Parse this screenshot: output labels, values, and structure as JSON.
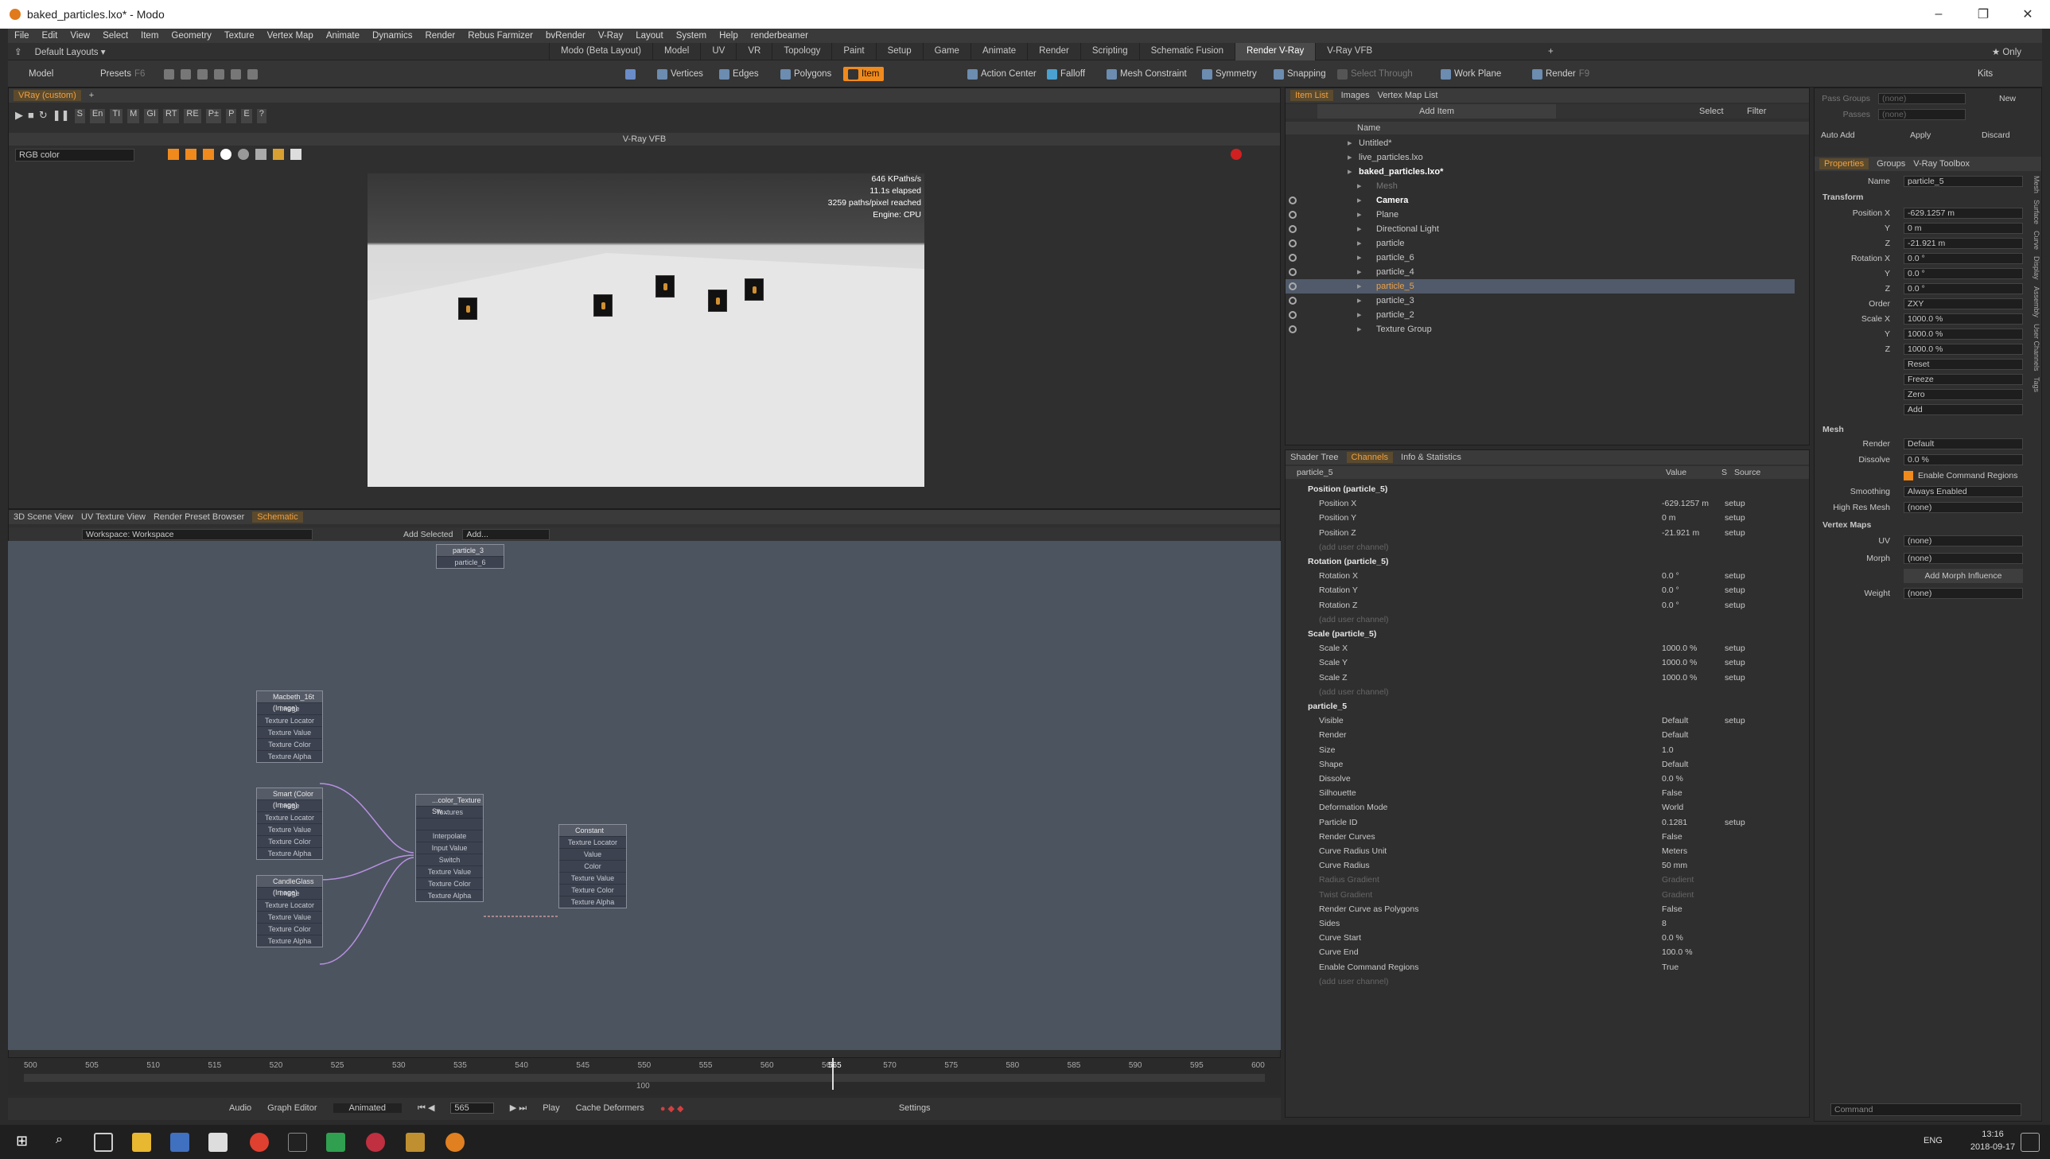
{
  "window": {
    "title": "baked_particles.lxo* - Modo",
    "min": "–",
    "max": "❐",
    "close": "✕"
  },
  "menu": [
    "File",
    "Edit",
    "View",
    "Select",
    "Item",
    "Geometry",
    "Texture",
    "Vertex Map",
    "Animate",
    "Dynamics",
    "Render",
    "Rebus Farmizer",
    "bvRender",
    "V-Ray",
    "Layout",
    "System",
    "Help",
    "renderbeamer"
  ],
  "layout": {
    "label": "Default Layouts ▾",
    "tabs": [
      "Modo (Beta Layout)",
      "Model",
      "UV",
      "VR",
      "Topology",
      "Paint",
      "Setup",
      "Game",
      "Animate",
      "Render",
      "Scripting",
      "Schematic Fusion",
      "Render V-Ray",
      "V-Ray VFB"
    ],
    "active_tab": "Render V-Ray",
    "plus": "+",
    "only": "★ Only"
  },
  "toolbar": {
    "model": "Model",
    "presets": "Presets",
    "presets_key": "F6",
    "vertices": "Vertices",
    "edges": "Edges",
    "polygons": "Polygons",
    "item": "Item",
    "action_center": "Action Center",
    "falloff": "Falloff",
    "mesh_constraint": "Mesh Constraint",
    "symmetry": "Symmetry",
    "snapping": "Snapping",
    "select_through": "Select Through",
    "work_plane": "Work Plane",
    "render": "Render",
    "render_key": "F9",
    "kits": "Kits"
  },
  "vfb": {
    "tab": "VRay (custom)",
    "title": "V-Ray VFB",
    "channel": "RGB color",
    "stats": [
      "646 KPaths/s",
      "11.1s elapsed",
      "3259 paths/pixel reached",
      "Engine: CPU"
    ],
    "buttons": [
      "S",
      "En",
      "TI",
      "M",
      "GI",
      "RT",
      "RE",
      "P±",
      "P",
      "E",
      "?"
    ]
  },
  "schematic": {
    "tabs": [
      "3D Scene View",
      "UV Texture View",
      "Render Preset Browser",
      "Schematic"
    ],
    "active": "Schematic",
    "workspace": "Workspace: Workspace",
    "add_selected": "Add Selected",
    "add": "Add...",
    "nodes": [
      {
        "title": "Macbeth_16t (Image)",
        "rows": [
          "Image",
          "Texture Locator",
          "Texture Value",
          "Texture Color",
          "Texture Alpha"
        ]
      },
      {
        "title": "Smart (Color (Image)",
        "rows": [
          "Image",
          "Texture Locator",
          "Texture Value",
          "Texture Color",
          "Texture Alpha"
        ]
      },
      {
        "title": "CandleGlass (Image)",
        "rows": [
          "Image",
          "Texture Locator",
          "Texture Value",
          "Texture Color",
          "Texture Alpha"
        ]
      },
      {
        "title": "...color_Texture Sw...",
        "rows": [
          "Textures",
          "",
          "Interpolate",
          "Input Value",
          "Switch",
          "Texture Value",
          "Texture Color",
          "Texture Alpha"
        ]
      },
      {
        "title": "Constant",
        "rows": [
          "Texture Locator",
          "Value",
          "Color",
          "Texture Value",
          "Texture Color",
          "Texture Alpha"
        ]
      },
      {
        "title": "particle_3",
        "rows": [
          "particle_6"
        ]
      }
    ]
  },
  "timeline": {
    "ticks": [
      "500",
      "505",
      "510",
      "515",
      "520",
      "525",
      "530",
      "535",
      "540",
      "545",
      "550",
      "555",
      "560",
      "565",
      "570",
      "575",
      "580",
      "585",
      "590",
      "595",
      "600"
    ],
    "markers": [
      "100",
      "565"
    ],
    "audio": "Audio",
    "graph_editor": "Graph Editor",
    "animated": "Animated",
    "frame": "565",
    "play": "Play",
    "cache": "Cache Deformers",
    "settings": "Settings"
  },
  "itemlist": {
    "tabs": [
      "Item List",
      "Images",
      "Vertex Map List"
    ],
    "add_item": "Add Item",
    "select": "Select",
    "filter": "Filter",
    "col": "Name",
    "items": [
      {
        "name": "Untitled*",
        "indent": 0
      },
      {
        "name": "live_particles.lxo",
        "indent": 0
      },
      {
        "name": "baked_particles.lxo*",
        "indent": 0,
        "bold": true
      },
      {
        "name": "Mesh",
        "indent": 1,
        "dim": true
      },
      {
        "name": "Camera",
        "indent": 1,
        "bold": true
      },
      {
        "name": "Plane",
        "indent": 1
      },
      {
        "name": "Directional Light",
        "indent": 1
      },
      {
        "name": "particle",
        "indent": 1
      },
      {
        "name": "particle_6",
        "indent": 1
      },
      {
        "name": "particle_4",
        "indent": 1
      },
      {
        "name": "particle_5",
        "indent": 1,
        "sel": true
      },
      {
        "name": "particle_3",
        "indent": 1
      },
      {
        "name": "particle_2",
        "indent": 1
      },
      {
        "name": "Texture Group",
        "indent": 1
      }
    ]
  },
  "channels": {
    "tabs": [
      "Shader Tree",
      "Channels",
      "Info & Statistics"
    ],
    "active": "Channels",
    "header": [
      "particle_5",
      "Value",
      "S",
      "Source"
    ],
    "rows": [
      {
        "n": "Position (particle_5)",
        "g": true
      },
      {
        "n": "Position X",
        "v": "-629.1257 m",
        "s": "setup"
      },
      {
        "n": "Position Y",
        "v": "0 m",
        "s": "setup"
      },
      {
        "n": "Position Z",
        "v": "-21.921 m",
        "s": "setup"
      },
      {
        "n": "(add user channel)",
        "d": true
      },
      {
        "n": "Rotation (particle_5)",
        "g": true
      },
      {
        "n": "Rotation X",
        "v": "0.0 °",
        "s": "setup"
      },
      {
        "n": "Rotation Y",
        "v": "0.0 °",
        "s": "setup"
      },
      {
        "n": "Rotation Z",
        "v": "0.0 °",
        "s": "setup"
      },
      {
        "n": "(add user channel)",
        "d": true
      },
      {
        "n": "Scale (particle_5)",
        "g": true
      },
      {
        "n": "Scale X",
        "v": "1000.0 %",
        "s": "setup"
      },
      {
        "n": "Scale Y",
        "v": "1000.0 %",
        "s": "setup"
      },
      {
        "n": "Scale Z",
        "v": "1000.0 %",
        "s": "setup"
      },
      {
        "n": "(add user channel)",
        "d": true
      },
      {
        "n": "particle_5",
        "g": true
      },
      {
        "n": "Visible",
        "v": "Default",
        "s": "setup"
      },
      {
        "n": "Render",
        "v": "Default"
      },
      {
        "n": "Size",
        "v": "1.0"
      },
      {
        "n": "Shape",
        "v": "Default"
      },
      {
        "n": "Dissolve",
        "v": "0.0 %"
      },
      {
        "n": "Silhouette",
        "v": "False"
      },
      {
        "n": "Deformation Mode",
        "v": "World"
      },
      {
        "n": "Particle ID",
        "v": "0.1281",
        "s": "setup"
      },
      {
        "n": "Render Curves",
        "v": "False"
      },
      {
        "n": "Curve Radius Unit",
        "v": "Meters"
      },
      {
        "n": "Curve Radius",
        "v": "50 mm"
      },
      {
        "n": "Radius Gradient",
        "v": "Gradient",
        "d": true
      },
      {
        "n": "Twist Gradient",
        "v": "Gradient",
        "d": true
      },
      {
        "n": "Render Curve as Polygons",
        "v": "False"
      },
      {
        "n": "Sides",
        "v": "8"
      },
      {
        "n": "Curve Start",
        "v": "0.0 %"
      },
      {
        "n": "Curve End",
        "v": "100.0 %"
      },
      {
        "n": "Enable Command Regions",
        "v": "True"
      },
      {
        "n": "(add user channel)",
        "d": true
      }
    ]
  },
  "properties": {
    "pass_groups": "Pass Groups",
    "passes": "Passes",
    "none": "(none)",
    "new": "New",
    "auto_add": "Auto Add",
    "apply": "Apply",
    "discard": "Discard",
    "tabs": [
      "Properties",
      "Groups",
      "V-Ray Toolbox"
    ],
    "name_label": "Name",
    "name": "particle_5",
    "transform": "Transform",
    "rows": [
      {
        "l": "Position X",
        "v": "-629.1257 m"
      },
      {
        "l": "Y",
        "v": "0 m"
      },
      {
        "l": "Z",
        "v": "-21.921 m"
      },
      {
        "l": "Rotation X",
        "v": "0.0 °"
      },
      {
        "l": "Y",
        "v": "0.0 °"
      },
      {
        "l": "Z",
        "v": "0.0 °"
      },
      {
        "l": "Order",
        "v": "ZXY"
      },
      {
        "l": "Scale X",
        "v": "1000.0 %"
      },
      {
        "l": "Y",
        "v": "1000.0 %"
      },
      {
        "l": "Z",
        "v": "1000.0 %"
      },
      {
        "l": "",
        "v": "Reset"
      },
      {
        "l": "",
        "v": "Freeze"
      },
      {
        "l": "",
        "v": "Zero"
      },
      {
        "l": "",
        "v": "Add"
      }
    ],
    "mesh": "Mesh",
    "mesh_rows": [
      {
        "l": "Render",
        "v": "Default"
      },
      {
        "l": "Dissolve",
        "v": "0.0 %"
      }
    ],
    "enable_cmd": "Enable Command Regions",
    "smoothing_l": "Smoothing",
    "smoothing": "Always Enabled",
    "highres_l": "High Res Mesh",
    "highres": "(none)",
    "vertex_maps": "Vertex Maps",
    "uv_l": "UV",
    "morph_l": "Morph",
    "add_morph": "Add Morph Influence",
    "weight_l": "Weight",
    "side_tabs": [
      "Mesh",
      "Surface",
      "Curve",
      "Display",
      "Assembly",
      "User Channels",
      "Tags"
    ],
    "command": "Command"
  },
  "taskbar": {
    "time": "13:16",
    "date": "2018-09-17",
    "lang": "ENG"
  }
}
